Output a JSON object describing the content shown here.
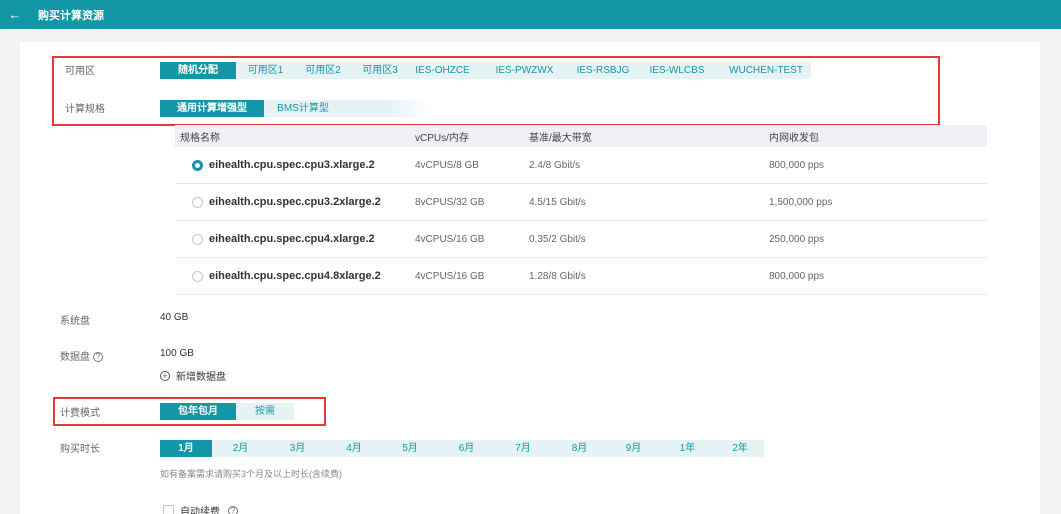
{
  "header": {
    "back_icon": "←",
    "title": "购买计算资源"
  },
  "zone": {
    "label": "可用区",
    "options": [
      "随机分配",
      "可用区1",
      "可用区2",
      "可用区3",
      "IES-OHZCE",
      "IES-PWZWX",
      "IES-RSBJG",
      "IES-WLCBS",
      "WUCHEN-TEST"
    ],
    "selected": "随机分配"
  },
  "spec_type": {
    "label": "计算规格",
    "options": [
      "通用计算增强型",
      "BMS计算型"
    ],
    "selected": "通用计算增强型"
  },
  "spec_table": {
    "headers": [
      "规格名称",
      "vCPUs/内存",
      "基准/最大带宽",
      "内网收发包"
    ],
    "rows": [
      {
        "name": "eihealth.cpu.spec.cpu3.xlarge.2",
        "vcpu": "4vCPUS/8 GB",
        "bandwidth": "2.4/8 Gbit/s",
        "pps": "800,000 pps",
        "selected": true
      },
      {
        "name": "eihealth.cpu.spec.cpu3.2xlarge.2",
        "vcpu": "8vCPUS/32 GB",
        "bandwidth": "4.5/15 Gbit/s",
        "pps": "1,500,000 pps",
        "selected": false
      },
      {
        "name": "eihealth.cpu.spec.cpu4.xlarge.2",
        "vcpu": "4vCPUS/16 GB",
        "bandwidth": "0.35/2 Gbit/s",
        "pps": "250,000 pps",
        "selected": false
      },
      {
        "name": "eihealth.cpu.spec.cpu4.8xlarge.2",
        "vcpu": "4vCPUS/16 GB",
        "bandwidth": "1.28/8 Gbit/s",
        "pps": "800,000 pps",
        "selected": false
      }
    ]
  },
  "system_disk": {
    "label": "系统盘",
    "value": "40 GB"
  },
  "data_disk": {
    "label": "数据盘",
    "help_icon": "?",
    "value": "100 GB",
    "add_icon": "+",
    "add_label": "新增数据盘"
  },
  "billing": {
    "label": "计费模式",
    "options": [
      "包年包月",
      "按需"
    ],
    "selected": "包年包月"
  },
  "duration": {
    "label": "购买时长",
    "options": [
      "1月",
      "2月",
      "3月",
      "4月",
      "5月",
      "6月",
      "7月",
      "8月",
      "9月",
      "1年",
      "2年"
    ],
    "selected": "1月",
    "hint": "如有备案需求请购买3个月及以上时长(含续费)"
  },
  "auto_renew": {
    "label": "自动续费",
    "help_icon": "?"
  },
  "colors": {
    "accent": "#1397a6",
    "highlight": "#e53935"
  }
}
